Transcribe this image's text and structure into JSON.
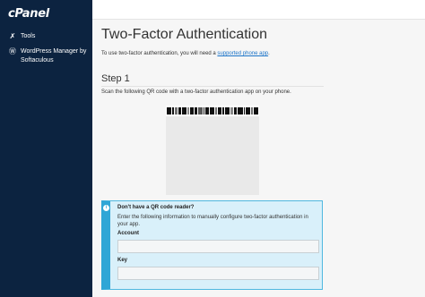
{
  "app": {
    "brand": "cPanel"
  },
  "sidebar": {
    "items": [
      {
        "label": "Tools",
        "icon": "wrench-icon"
      },
      {
        "label": "WordPress Manager by Softaculous",
        "icon": "wordpress-icon"
      }
    ]
  },
  "main": {
    "title": "Two-Factor Authentication",
    "intro_prefix": "To use two-factor authentication, you will need a ",
    "intro_link": "supported phone app",
    "intro_suffix": ".",
    "step_title": "Step 1",
    "scan_text": "Scan the following QR code with a two-factor authentication app on your phone."
  },
  "info_box": {
    "heading": "Don't have a QR code reader?",
    "text": "Enter the following information to manually configure two-factor authentication in your app.",
    "account_label": "Account",
    "account_value": "",
    "key_label": "Key",
    "key_value": ""
  },
  "colors": {
    "sidebar_bg": "#0c2340",
    "link": "#1a73c8",
    "info_accent": "#2fa6d6",
    "info_bg": "#d9f0fa"
  }
}
